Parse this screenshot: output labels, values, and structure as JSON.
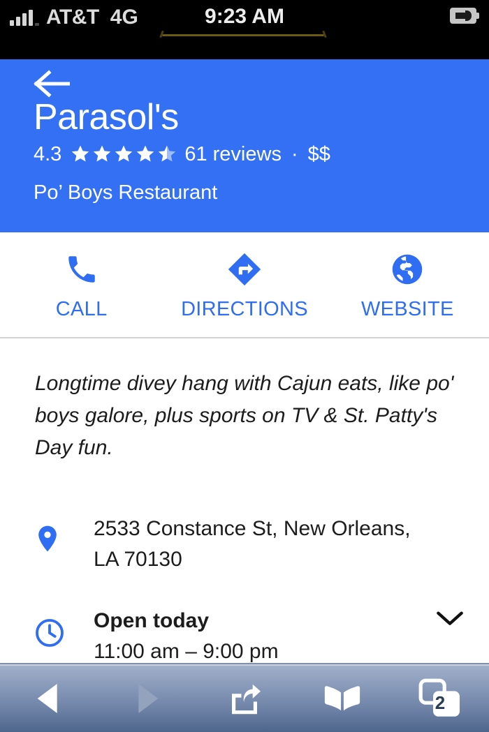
{
  "status_bar": {
    "carrier": "AT&T",
    "network": "4G",
    "time": "9:23 AM",
    "signal_icon": "signal-bars-icon",
    "battery_icon": "battery-charging-icon"
  },
  "header": {
    "back_icon": "back-arrow-icon",
    "title": "Parasol's",
    "rating": "4.3",
    "stars_filled": 4.5,
    "reviews": "61 reviews",
    "separator": "·",
    "price_level": "$$",
    "category": "Po’ Boys Restaurant",
    "background_color": "#3370f4"
  },
  "actions": [
    {
      "label": "CALL",
      "icon": "phone-icon"
    },
    {
      "label": "DIRECTIONS",
      "icon": "directions-icon"
    },
    {
      "label": "WEBSITE",
      "icon": "globe-icon"
    }
  ],
  "description": "Longtime divey hang with Cajun eats, like po' boys galore, plus sports on TV & St. Patty's Day fun.",
  "info_rows": [
    {
      "icon": "location-pin-icon",
      "primary": "2533 Constance St, New Orleans,",
      "secondary": "LA 70130"
    },
    {
      "icon": "clock-icon",
      "primary": "Open today",
      "secondary": "11:00 am – 9:00 pm",
      "chevron_icon": "chevron-down-icon"
    }
  ],
  "toolbar": {
    "items": [
      {
        "icon": "back-triangle-icon",
        "enabled": true
      },
      {
        "icon": "forward-triangle-icon",
        "enabled": false
      },
      {
        "icon": "share-icon",
        "enabled": true
      },
      {
        "icon": "bookmarks-book-icon",
        "enabled": true
      },
      {
        "icon": "tabs-icon",
        "enabled": true,
        "badge": "2"
      }
    ]
  },
  "colors": {
    "accent_blue": "#3370f4",
    "link_blue": "#2f6ef2",
    "text_dark": "#1c1c1c"
  }
}
